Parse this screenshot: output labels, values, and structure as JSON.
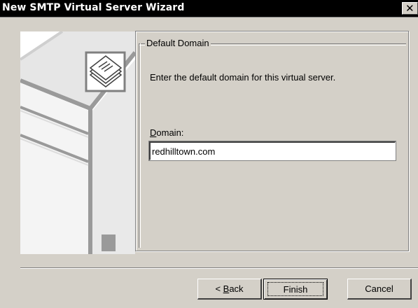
{
  "window": {
    "title": "New SMTP Virtual Server Wizard",
    "close_glyph": "✕"
  },
  "section": {
    "legend": "Default Domain",
    "description": "Enter the default domain for this virtual server."
  },
  "domain_field": {
    "label_accel": "D",
    "label_rest": "omain:",
    "value": "redhilltown.com"
  },
  "buttons": {
    "back_prefix": "< ",
    "back_accel": "B",
    "back_rest": "ack",
    "finish": "Finish",
    "cancel": "Cancel"
  },
  "illustration": {
    "icon": "mail-stack-icon"
  }
}
